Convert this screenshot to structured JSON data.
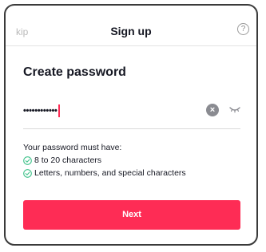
{
  "header": {
    "skip_label": "kip",
    "title": "Sign up",
    "help_glyph": "?"
  },
  "main": {
    "heading": "Create password",
    "password_field": {
      "masked_value": "••••••••••••"
    },
    "requirements": {
      "title": "Your password must have:",
      "items": [
        {
          "label": "8 to 20 characters",
          "met": true
        },
        {
          "label": "Letters, numbers, and special characters",
          "met": true
        }
      ]
    },
    "next_label": "Next"
  },
  "icons": {
    "help": "question-circle-icon",
    "clear": "clear-x-icon",
    "visibility": "eye-closed-icon",
    "check": "check-circle-icon"
  },
  "colors": {
    "accent": "#fe2c55",
    "check_green": "#3fc28a",
    "text": "#161823"
  }
}
